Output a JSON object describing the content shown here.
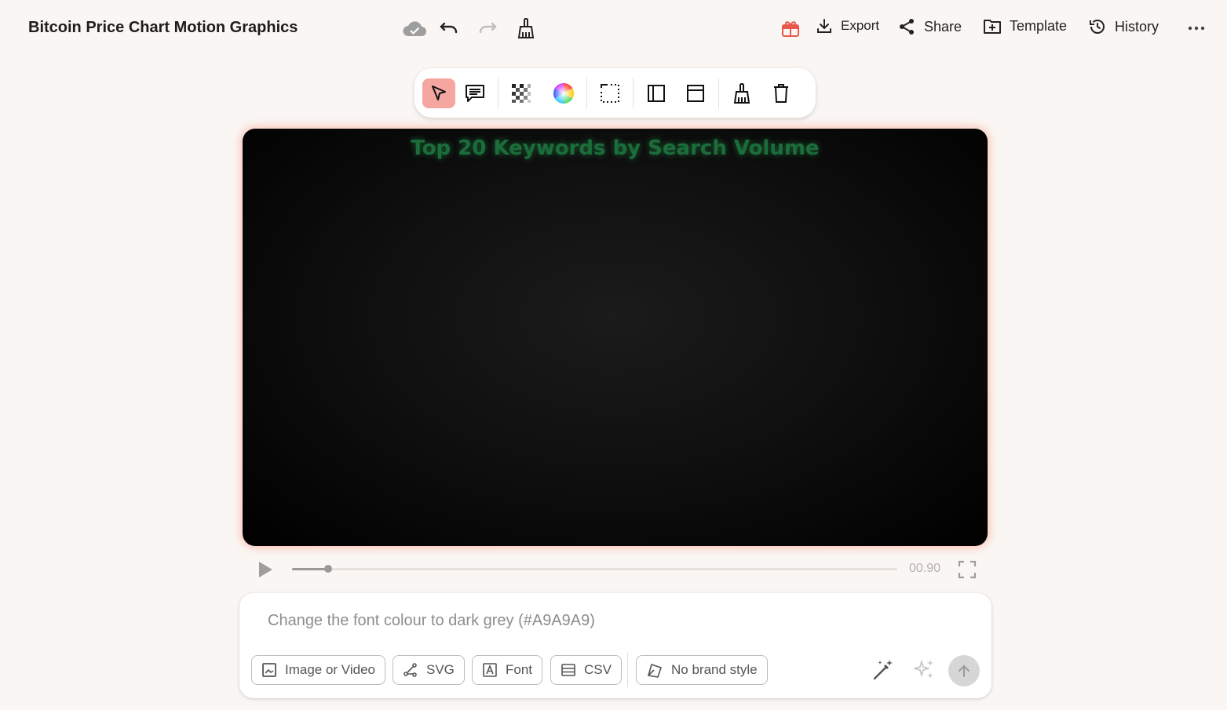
{
  "header": {
    "title": "Bitcoin Price Chart Motion Graphics",
    "export_label": "Export",
    "share_label": "Share",
    "template_label": "Template",
    "history_label": "History"
  },
  "toolbar": {
    "tools": [
      "select",
      "comment",
      "transparency",
      "color",
      "crop",
      "panel-left",
      "panel-top",
      "clean",
      "delete"
    ],
    "active_tool": "select",
    "active_color": "#f6a6a0"
  },
  "canvas": {
    "title": "Top 20 Keywords by Search Volume",
    "title_color": "#1b6d3a"
  },
  "player": {
    "time": "00.90",
    "progress": 0.06
  },
  "prompt": {
    "placeholder": "Change the font colour to dark grey (#A9A9A9)",
    "chips": {
      "media": "Image or Video",
      "svg": "SVG",
      "font": "Font",
      "csv": "CSV",
      "brand": "No brand style"
    }
  },
  "colors": {
    "accent": "#e8594b",
    "background": "#faf6f3",
    "glow": "#faa08c"
  }
}
